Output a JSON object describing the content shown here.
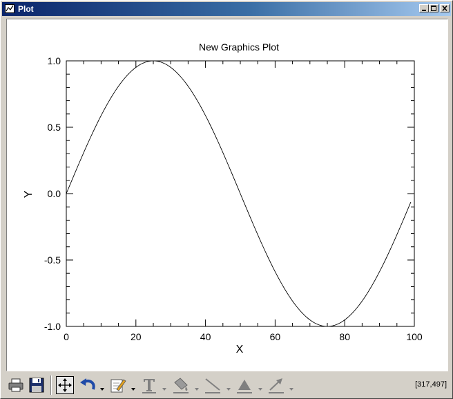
{
  "window": {
    "title": "Plot",
    "controls": {
      "minimize": "minimize",
      "maximize": "maximize",
      "close": "close"
    }
  },
  "chart_data": {
    "type": "line",
    "title": "New Graphics Plot",
    "xlabel": "X",
    "ylabel": "Y",
    "xlim": [
      0,
      100
    ],
    "ylim": [
      -1.0,
      1.0
    ],
    "xticks": [
      "0",
      "20",
      "40",
      "60",
      "80",
      "100"
    ],
    "yticks": [
      "1.0",
      "0.5",
      "0.0",
      "-0.5",
      "-1.0"
    ],
    "series": [
      {
        "function": "sin(2*pi*x/100)",
        "x": [
          0,
          5,
          10,
          15,
          20,
          25,
          30,
          35,
          40,
          45,
          50,
          55,
          60,
          65,
          70,
          75,
          80,
          85,
          90,
          95,
          99
        ],
        "y": [
          0,
          0.309,
          0.588,
          0.809,
          0.951,
          1.0,
          0.951,
          0.809,
          0.588,
          0.309,
          0,
          -0.309,
          -0.588,
          -0.809,
          -0.951,
          -1.0,
          -0.951,
          -0.809,
          -0.588,
          -0.309,
          -0.063
        ]
      }
    ],
    "grid": false,
    "line_color": "#000000"
  },
  "toolbar": {
    "items": [
      "print-icon",
      "save-icon",
      "pan-icon",
      "undo-icon",
      "edit-icon",
      "text-icon",
      "paint-icon",
      "line-icon",
      "fill-icon",
      "arrow-icon"
    ],
    "coordinates": "[317,497]"
  }
}
